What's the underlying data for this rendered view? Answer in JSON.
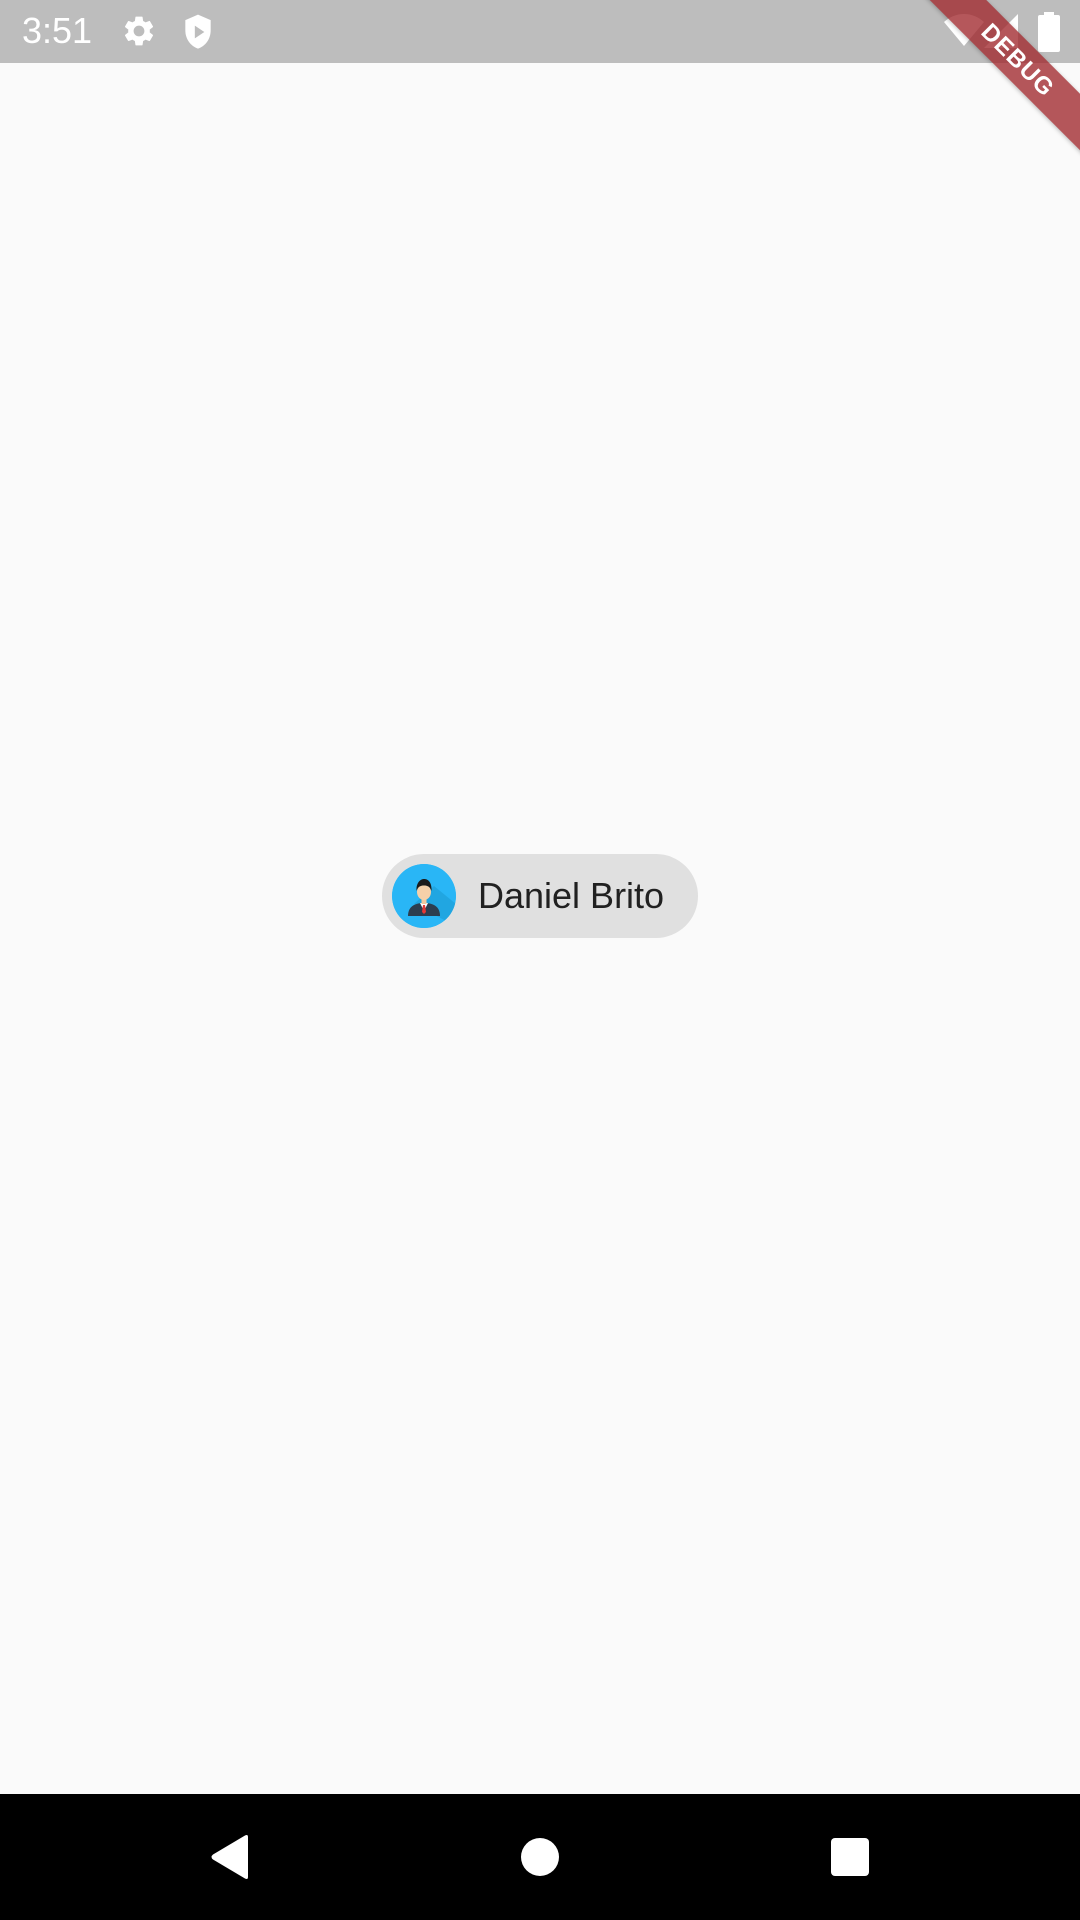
{
  "status_bar": {
    "time": "3:51",
    "icons": [
      "settings-icon",
      "shield-icon",
      "wifi-icon",
      "signal-icon",
      "battery-icon"
    ],
    "background": "#bdbdbd"
  },
  "debug_banner": {
    "label": "DEBUG",
    "color": "#a0282d"
  },
  "chip": {
    "label": "Daniel Brito",
    "avatar_icon": "user-avatar-icon",
    "background": "#e0e0e0",
    "avatar_color": "#29b6f6"
  },
  "nav_bar": {
    "buttons": [
      "back-icon",
      "home-icon",
      "recents-icon"
    ]
  }
}
